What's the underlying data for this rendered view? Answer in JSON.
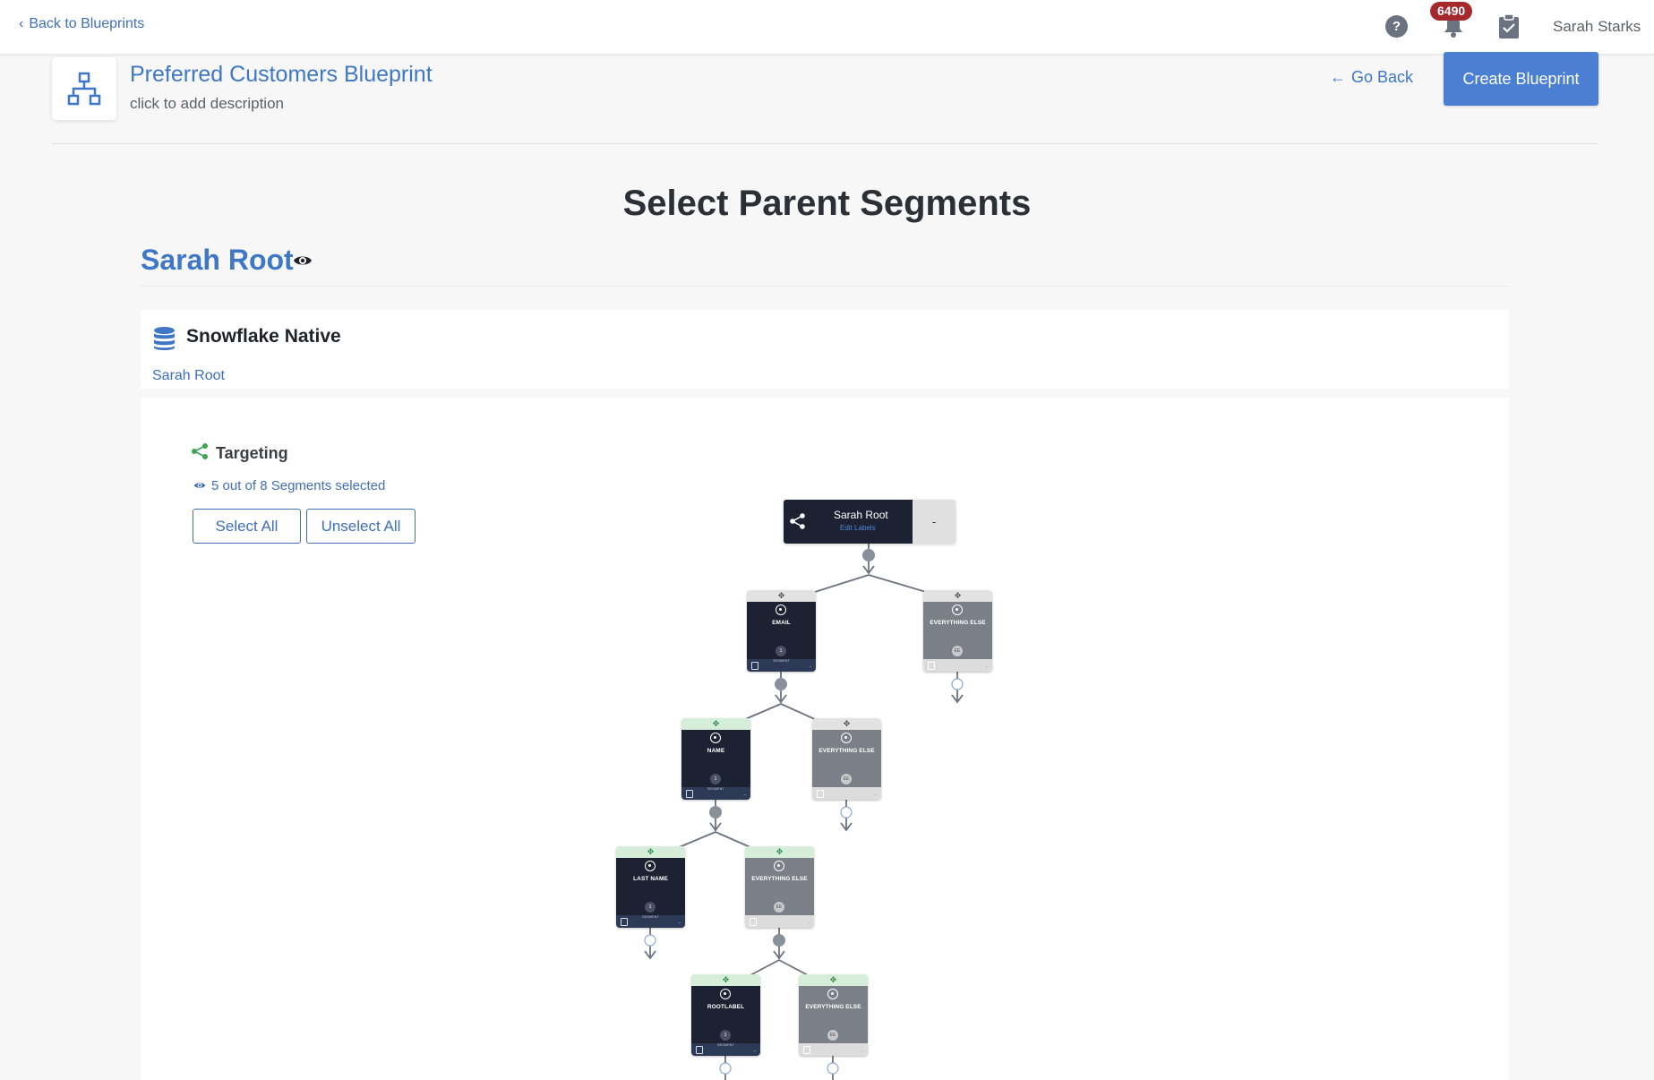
{
  "topbar": {
    "back_label": "Back to Blueprints",
    "help_icon": "question-circle-icon",
    "notification_count": "6490",
    "user_name": "Sarah Starks"
  },
  "header": {
    "title": "Preferred Customers Blueprint",
    "description": "click to add description",
    "go_back_label": "Go Back",
    "create_label": "Create Blueprint"
  },
  "page_title": "Select Parent Segments",
  "root": {
    "name": "Sarah Root"
  },
  "source": {
    "name": "Snowflake Native",
    "link": "Sarah Root"
  },
  "targeting": {
    "label": "Targeting",
    "selection_text": "5 out of 8 Segments selected",
    "select_all_label": "Select All",
    "unselect_all_label": "Unselect All"
  },
  "tree": {
    "root_node": {
      "name": "Sarah Root",
      "sub": "Edit Labels",
      "value": "-"
    },
    "segments": [
      {
        "label": "EMAIL",
        "count": "1",
        "unit": "SEGMENT",
        "style": "dark",
        "header": "gray"
      },
      {
        "label": "EVERYTHING ELSE",
        "count": "EE",
        "unit": "",
        "style": "grey",
        "header": "gray"
      },
      {
        "label": "NAME",
        "count": "1",
        "unit": "SEGMENT",
        "style": "dark",
        "header": "green"
      },
      {
        "label": "EVERYTHING ELSE",
        "count": "EE",
        "unit": "",
        "style": "grey",
        "header": "gray"
      },
      {
        "label": "LAST NAME",
        "count": "1",
        "unit": "SEGMENT",
        "style": "dark",
        "header": "green"
      },
      {
        "label": "EVERYTHING ELSE",
        "count": "EE",
        "unit": "",
        "style": "grey",
        "header": "green"
      },
      {
        "label": "ROOTLABEL",
        "count": "1",
        "unit": "SEGMENT",
        "style": "dark",
        "header": "green"
      },
      {
        "label": "EVERYTHING ELSE",
        "count": "EE",
        "unit": "",
        "style": "grey",
        "header": "green"
      }
    ]
  },
  "colors": {
    "accent": "#3f77c7",
    "button_primary": "#4a7fd4",
    "badge": "#a4282c",
    "node_dark": "#1d2232",
    "node_grey": "#7b8088",
    "targeting_icon": "#3fa35a"
  }
}
